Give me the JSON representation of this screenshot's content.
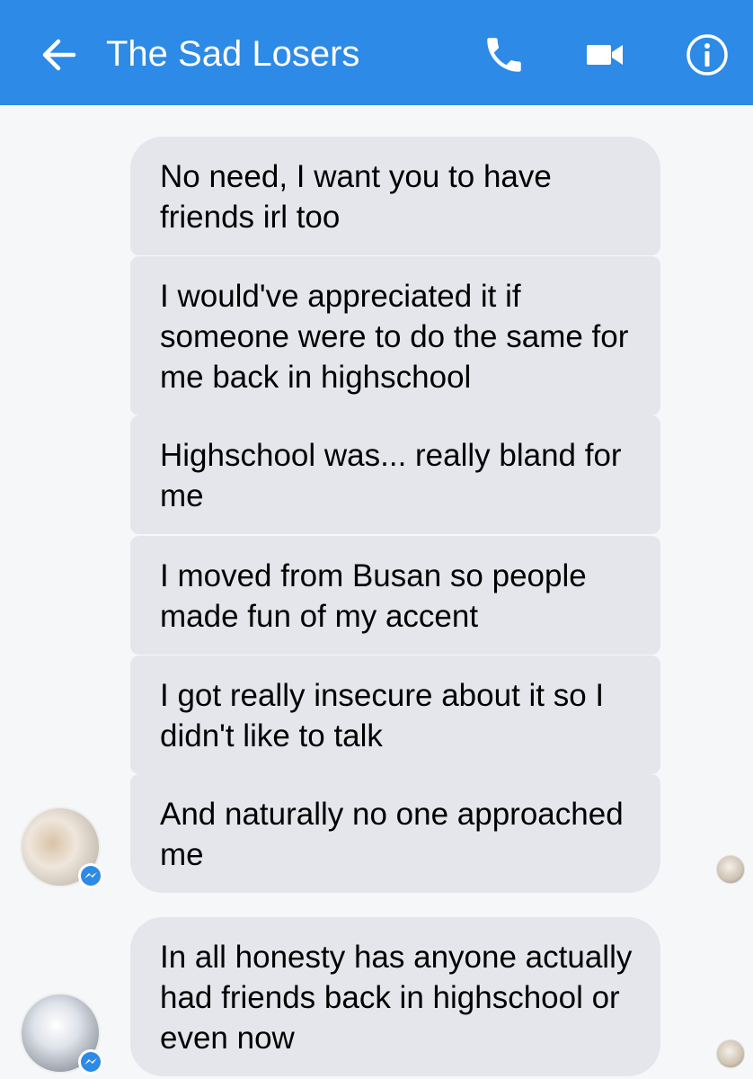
{
  "theme": {
    "accent": "#2d8ae6",
    "bubble_bg": "#e4e6eb"
  },
  "header": {
    "title": "The Sad Losers",
    "icons": [
      "back-arrow-icon",
      "phone-icon",
      "video-camera-icon",
      "info-icon"
    ]
  },
  "messages": [
    {
      "text": "No need, I want you to have friends irl too"
    },
    {
      "text": "I would've appreciated it if someone were to do the same for me back in highschool"
    },
    {
      "text": "Highschool was... really bland for me"
    },
    {
      "text": "I moved from Busan so people made fun of my accent"
    },
    {
      "text": "I got really insecure about it so I didn't like to talk"
    },
    {
      "text": "And naturally no one approached me"
    },
    {
      "text": "In all honesty has anyone actually had friends back in highschool or even now"
    }
  ]
}
